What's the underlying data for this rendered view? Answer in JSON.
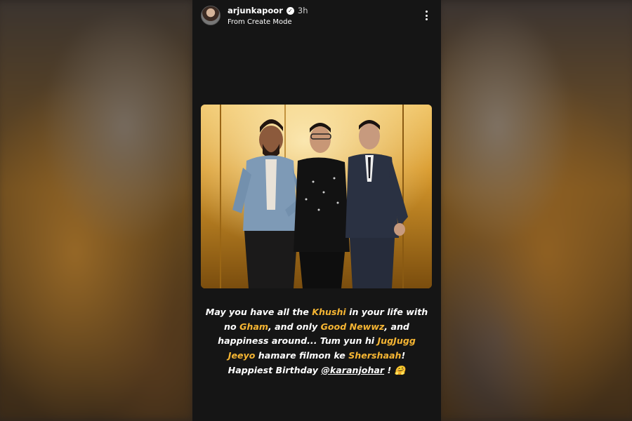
{
  "story": {
    "username": "arjunkapoor",
    "time": "3h",
    "subtitle": "From Create Mode",
    "caption": [
      {
        "text": "May you have all the ",
        "highlight": false
      },
      {
        "text": "Khushi",
        "highlight": true
      },
      {
        "text": " in your life with no ",
        "highlight": false
      },
      {
        "text": "Gham",
        "highlight": true
      },
      {
        "text": ", and only ",
        "highlight": false
      },
      {
        "text": "Good Newwz",
        "highlight": true
      },
      {
        "text": ", and happiness around... Tum yun hi ",
        "highlight": false
      },
      {
        "text": "JugJugg Jeeyo",
        "highlight": true
      },
      {
        "text": " hamare filmon ke ",
        "highlight": false
      },
      {
        "text": "Shershaah",
        "highlight": true
      },
      {
        "text": "! Happiest Birthday ",
        "highlight": false
      },
      {
        "text": "@karanjohar",
        "highlight": false,
        "mention": true
      },
      {
        "text": " ! 🤗",
        "highlight": false
      }
    ]
  },
  "icons": {
    "verified": "verified-badge-icon",
    "more": "more-options-icon"
  },
  "colors": {
    "story_background": "#151515",
    "highlight": "#f5b533",
    "text": "#ffffff"
  }
}
